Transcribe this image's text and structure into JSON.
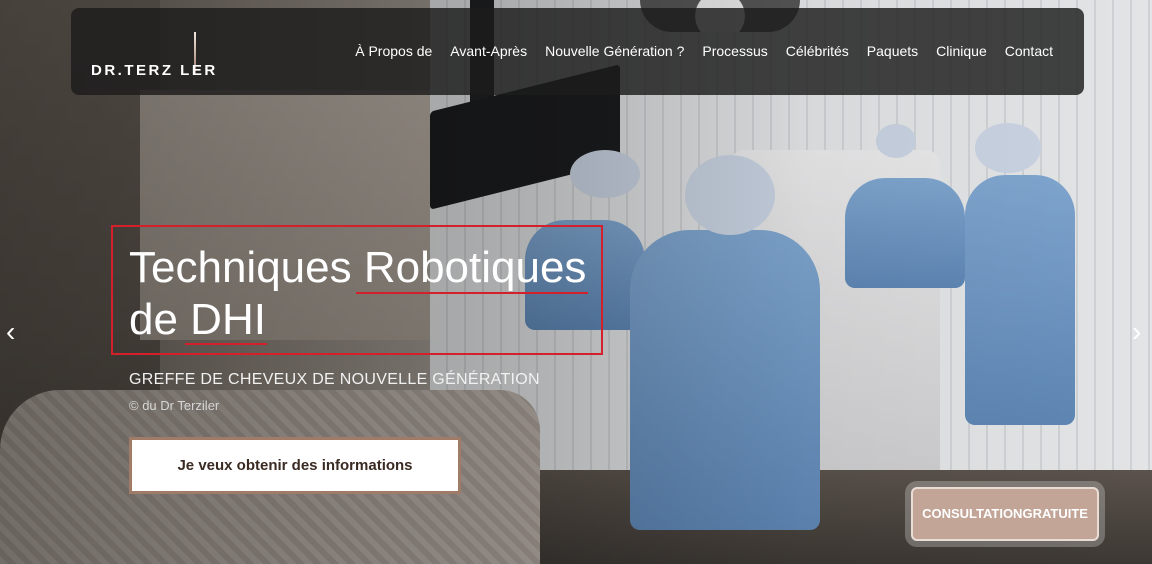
{
  "brand": {
    "logo_text": "DR.TERZ LER"
  },
  "nav": {
    "items": [
      "À Propos de",
      "Avant-Après",
      "Nouvelle Génération ?",
      "Processus",
      "Célébrités",
      "Paquets",
      "Clinique",
      "Contact"
    ]
  },
  "hero": {
    "headline_line1": "Techniques Robotiques",
    "headline_line2": "de DHI",
    "subtitle": "GREFFE DE CHEVEUX DE NOUVELLE GÉNÉRATION",
    "credit": "© du Dr Terziler",
    "cta_label": "Je veux obtenir des informations"
  },
  "slider": {
    "prev_glyph": "‹",
    "next_glyph": "›"
  },
  "consultation": {
    "line1": "CONSULTATION",
    "line2": "GRATUITE"
  },
  "colors": {
    "accent": "#a07b67",
    "highlight": "#d3202a",
    "consult_bg": "#c2a597"
  },
  "icons": [
    "chevron-left-icon",
    "chevron-right-icon"
  ]
}
